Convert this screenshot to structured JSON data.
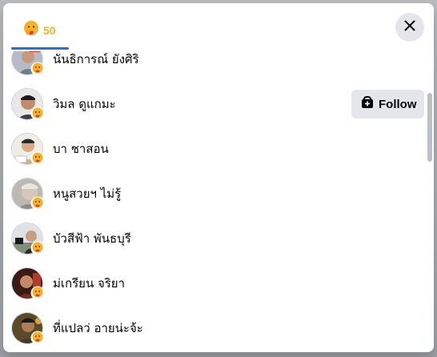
{
  "tabs": [
    {
      "reaction": "care",
      "count": "50"
    }
  ],
  "close": {
    "icon": "close-icon"
  },
  "follow_label": "Follow",
  "people": [
    {
      "name": "นันธิการณ์ ยังศิริ",
      "avatar_color": "#6b7a8c",
      "has_follow": false
    },
    {
      "name": "วิมล ดูแกมะ",
      "avatar_color": "#3a3f4a",
      "has_follow": true
    },
    {
      "name": "บา ชาสอน",
      "avatar_color": "#c9b48a",
      "has_follow": false
    },
    {
      "name": "หนูสวยฯ ไม่รู้",
      "avatar_color": "#8f8a86",
      "has_follow": false
    },
    {
      "name": "บัวสีฟ้า พันธบุรี",
      "avatar_color": "#7f8f78",
      "has_follow": false
    },
    {
      "name": "ม่เกรียน จริยา",
      "avatar_color": "#7a2a22",
      "has_follow": false
    },
    {
      "name": "ที่แปลว่ อายน่ะจ้ะ",
      "avatar_color": "#3d3a2e",
      "has_follow": false
    }
  ],
  "colors": {
    "accent": "#1b74e4",
    "care_count": "#f7b125",
    "button_bg": "#e4e6eb"
  }
}
